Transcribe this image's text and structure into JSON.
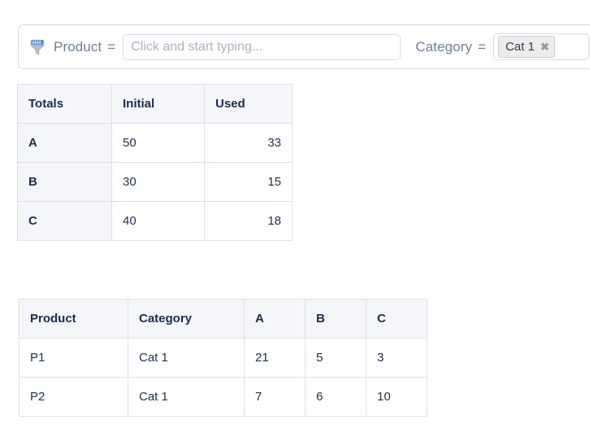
{
  "filter_bar": {
    "product_filter": {
      "icon": "filter-funnel-icon",
      "label": "Product",
      "operator": "=",
      "input_value": "",
      "placeholder": "Click and start typing..."
    },
    "category_filter": {
      "label": "Category",
      "operator": "=",
      "chips": [
        {
          "label": "Cat 1",
          "remove_icon": "close-x-icon",
          "remove_glyph": "✖"
        }
      ]
    }
  },
  "totals_table": {
    "headers": [
      "Totals",
      "Initial",
      "Used"
    ],
    "rows": [
      {
        "label": "A",
        "initial": "50",
        "used": "33"
      },
      {
        "label": "B",
        "initial": "30",
        "used": "15"
      },
      {
        "label": "C",
        "initial": "40",
        "used": "18"
      }
    ]
  },
  "products_table": {
    "headers": [
      "Product",
      "Category",
      "A",
      "B",
      "C"
    ],
    "rows": [
      {
        "product": "P1",
        "category": "Cat 1",
        "a": "21",
        "b": "5",
        "c": "3"
      },
      {
        "product": "P2",
        "category": "Cat 1",
        "a": "7",
        "b": "6",
        "c": "10"
      }
    ]
  },
  "colors": {
    "border": "#dbe0e8",
    "header_bg": "#f4f6f9",
    "text": "#203152",
    "label_text": "#6f7f94",
    "placeholder": "#a9b2c0",
    "chip_bg": "#ececec",
    "accent": "#4a90d9"
  }
}
